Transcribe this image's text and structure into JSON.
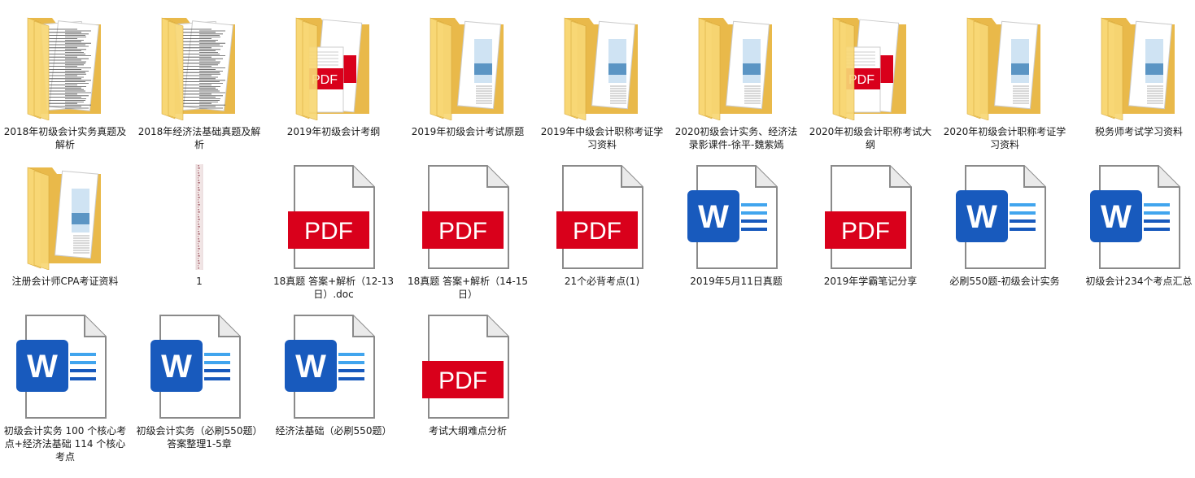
{
  "items": [
    {
      "label": "2018年初级会计实务真题及解析",
      "type": "folder",
      "variant": "docs"
    },
    {
      "label": "2018年经济法基础真题及解析",
      "type": "folder",
      "variant": "docs"
    },
    {
      "label": "2019年初级会计考纲",
      "type": "folder",
      "variant": "pdf"
    },
    {
      "label": "2019年初级会计考试原题",
      "type": "folder",
      "variant": "image"
    },
    {
      "label": "2019年中级会计职称考证学习资料",
      "type": "folder",
      "variant": "image"
    },
    {
      "label": "2020初级会计实务、经济法录影课件-徐平-魏紫嫣",
      "type": "folder",
      "variant": "image"
    },
    {
      "label": "2020年初级会计职称考试大纲",
      "type": "folder",
      "variant": "pdf"
    },
    {
      "label": "2020年初级会计职称考证学习资料",
      "type": "folder",
      "variant": "image"
    },
    {
      "label": "税务师考试学习资料",
      "type": "folder",
      "variant": "image"
    },
    {
      "label": "注册会计师CPA考证资料",
      "type": "folder",
      "variant": "image"
    },
    {
      "label": "1",
      "type": "strip"
    },
    {
      "label": "18真题 答案+解析（12-13日）.doc",
      "type": "pdf"
    },
    {
      "label": "18真题 答案+解析（14-15日）",
      "type": "pdf"
    },
    {
      "label": "21个必背考点(1)",
      "type": "pdf"
    },
    {
      "label": "2019年5月11日真题",
      "type": "word"
    },
    {
      "label": "2019年学霸笔记分享",
      "type": "pdf"
    },
    {
      "label": "必刷550题-初级会计实务",
      "type": "word"
    },
    {
      "label": "初级会计234个考点汇总",
      "type": "word"
    },
    {
      "label": "初级会计实务 100 个核心考点+经济法基础 114 个核心考点",
      "type": "word"
    },
    {
      "label": "初级会计实务（必刷550题）答案整理1-5章",
      "type": "word"
    },
    {
      "label": "经济法基础（必刷550题）",
      "type": "word"
    },
    {
      "label": "考试大纲难点分析",
      "type": "pdf"
    }
  ],
  "icon_text": {
    "pdf": "PDF",
    "word": "W",
    "small_pdf": "PDF"
  },
  "colors": {
    "folder_front": "#f8d775",
    "folder_back": "#e9b94a",
    "pdf_red": "#d9001b",
    "word_blue": "#185abd",
    "word_lines": "#41a5ee"
  }
}
